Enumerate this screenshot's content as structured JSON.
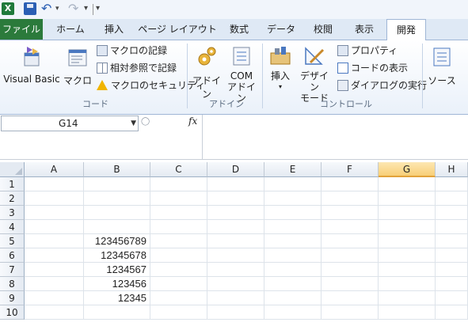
{
  "qat": {
    "xl_icon": "excel-icon",
    "save_icon": "save-icon",
    "undo_icon": "undo-icon",
    "redo_icon": "redo-icon"
  },
  "tabs": [
    "ファイル",
    "ホーム",
    "挿入",
    "ページ レイアウト",
    "数式",
    "データ",
    "校閲",
    "表示",
    "開発"
  ],
  "active_tab": "開発",
  "ribbon": {
    "code_group": {
      "visual_basic": "Visual Basic",
      "macro": "マクロ",
      "record_macro": "マクロの記録",
      "relative_ref": "相対参照で記録",
      "macro_security": "マクロのセキュリティ",
      "label": "コード"
    },
    "addin_group": {
      "addin": "アドイン",
      "com_line1": "COM",
      "com_line2": "アドイン",
      "label": "アドイン"
    },
    "control_group": {
      "insert": "挿入",
      "design_line1": "デザイン",
      "design_line2": "モード",
      "properties": "プロパティ",
      "view_code": "コードの表示",
      "dialog": "ダイアログの実行",
      "label": "コントロール"
    },
    "source": "ソース"
  },
  "formula_bar": {
    "name_box": "G14",
    "fx": "fx",
    "content": ""
  },
  "columns": [
    "A",
    "B",
    "C",
    "D",
    "E",
    "F",
    "G",
    "H"
  ],
  "selected_column": "G",
  "rows": [
    "1",
    "2",
    "3",
    "4",
    "5",
    "6",
    "7",
    "8",
    "9",
    "10"
  ],
  "cells": {
    "B5": "123456789",
    "B6": "12345678",
    "B7": "1234567",
    "B8": "123456",
    "B9": "12345"
  },
  "colors": {
    "file_tab": "#2b7a3b",
    "selected_col": "#f8cf77"
  }
}
